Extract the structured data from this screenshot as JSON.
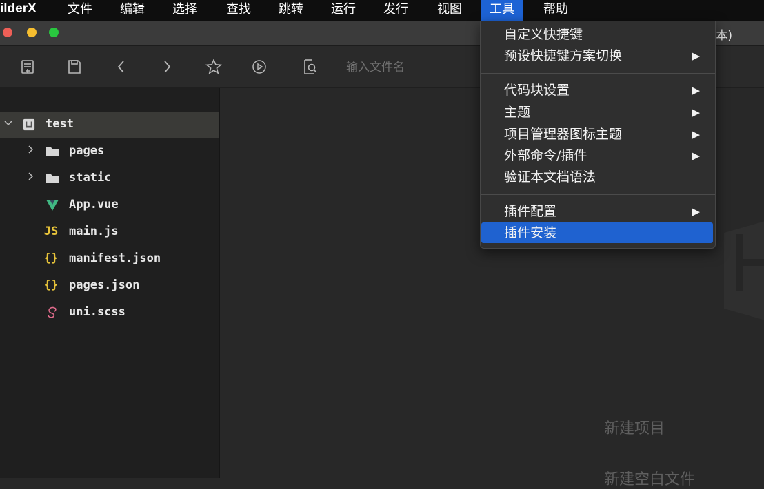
{
  "menubar": {
    "app_name": "ilderX",
    "menus": [
      "文件",
      "编辑",
      "选择",
      "查找",
      "跳转",
      "运行",
      "发行",
      "视图",
      "工具",
      "帮助"
    ]
  },
  "titlebar": {
    "title_suffix": "本)"
  },
  "toolbar": {
    "search_placeholder": "输入文件名"
  },
  "sidebar": {
    "root": "test",
    "items": [
      {
        "label": "pages",
        "type": "folder"
      },
      {
        "label": "static",
        "type": "folder"
      },
      {
        "label": "App.vue",
        "type": "vue"
      },
      {
        "label": "main.js",
        "type": "js",
        "icon_text": "JS"
      },
      {
        "label": "manifest.json",
        "type": "json",
        "icon_text": "{}"
      },
      {
        "label": "pages.json",
        "type": "json",
        "icon_text": "{}"
      },
      {
        "label": "uni.scss",
        "type": "scss"
      }
    ]
  },
  "tools_menu": {
    "items": [
      {
        "label": "自定义快捷键",
        "submenu": false
      },
      {
        "label": "预设快捷键方案切换",
        "submenu": true
      },
      {
        "label": "代码块设置",
        "submenu": true
      },
      {
        "label": "主题",
        "submenu": true
      },
      {
        "label": "项目管理器图标主题",
        "submenu": true
      },
      {
        "label": "外部命令/插件",
        "submenu": true
      },
      {
        "label": "验证本文档语法",
        "submenu": false
      },
      {
        "label": "插件配置",
        "submenu": true
      },
      {
        "label": "插件安装",
        "submenu": false,
        "highlighted": true
      }
    ],
    "arrow": "▶"
  },
  "editor": {
    "welcome_links": [
      "新建项目",
      "新建空白文件"
    ]
  },
  "colors": {
    "menubar_bg": "#0e0e0e",
    "accent": "#1f62d0",
    "sidebar_bg": "#1f1f1f",
    "editor_bg": "#282828",
    "vue_green": "#41b883",
    "js_yellow": "#e8c43a",
    "json_yellow": "#e8c43a",
    "scss_pink": "#e06b8b"
  }
}
